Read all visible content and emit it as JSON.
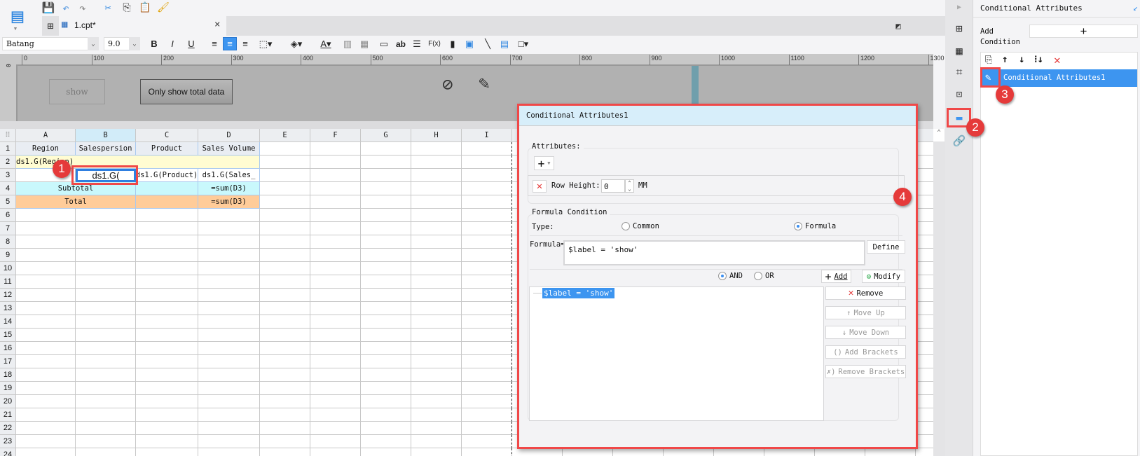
{
  "toolbar": {
    "icons": [
      "logo-icon",
      "save-icon",
      "undo-icon",
      "redo-icon",
      "cut-icon",
      "copy-icon",
      "paste-icon",
      "format-painter-icon"
    ]
  },
  "tab": {
    "label": "1.cpt*",
    "close": "×"
  },
  "format": {
    "font": "Batang",
    "size": "9.0",
    "bold": "B",
    "italic": "I",
    "underline": "U",
    "text_label": "ab",
    "formula": "F(x)"
  },
  "ruler": {
    "labels": [
      0,
      100,
      200,
      300,
      400,
      500,
      600,
      700,
      800,
      900,
      1000,
      1100,
      1200,
      1300
    ]
  },
  "report_body": {
    "show_button": "show",
    "total_button": "Only show total data"
  },
  "sheet": {
    "columns": [
      "A",
      "B",
      "C",
      "D",
      "E",
      "F",
      "G",
      "H",
      "I"
    ],
    "row_count": 24,
    "cells": [
      {
        "row": 1,
        "col": 0,
        "text": "Region",
        "style": "hdr"
      },
      {
        "row": 1,
        "col": 1,
        "text": "Salespersion",
        "style": "hdr"
      },
      {
        "row": 1,
        "col": 2,
        "text": "Product",
        "style": "hdr"
      },
      {
        "row": 1,
        "col": 3,
        "text": "Sales Volume",
        "style": "hdr"
      },
      {
        "row": 2,
        "col": 0,
        "span": 4,
        "text": "ds1.G(Region)",
        "style": "yellow",
        "align": "left"
      },
      {
        "row": 3,
        "col": 1,
        "text": "ds1.G(",
        "style": "editing"
      },
      {
        "row": 3,
        "col": 2,
        "text": "ds1.G(Product)",
        "style": "plain"
      },
      {
        "row": 3,
        "col": 3,
        "text": "ds1.G(Sales_",
        "style": "plain"
      },
      {
        "row": 4,
        "col": 0,
        "span": 2,
        "text": "Subtotal",
        "style": "cyan"
      },
      {
        "row": 4,
        "col": 2,
        "text": "",
        "style": "cyan"
      },
      {
        "row": 4,
        "col": 3,
        "text": "=sum(D3)",
        "style": "cyan"
      },
      {
        "row": 5,
        "col": 0,
        "span": 2,
        "text": "Total",
        "style": "orange"
      },
      {
        "row": 5,
        "col": 2,
        "text": "",
        "style": "orange"
      },
      {
        "row": 5,
        "col": 3,
        "text": "=sum(D3)",
        "style": "orange"
      }
    ]
  },
  "badges": [
    "1",
    "2",
    "3",
    "4"
  ],
  "panel": {
    "title": "Conditional Attributes",
    "add_condition": "Add Condition",
    "add_icon": "+",
    "items": [
      "Conditional Attributes1"
    ]
  },
  "dialog": {
    "title": "Conditional Attributes1",
    "attributes_label": "Attributes:",
    "row_height_label": "Row Height:",
    "row_height_value": "0",
    "unit": "MM",
    "formula_condition_label": "Formula Condition",
    "type_label": "Type:",
    "type_common": "Common",
    "type_formula": "Formula",
    "formula_label": "Formula=",
    "formula_value": "$label = 'show'",
    "define": "Define",
    "and": "AND",
    "or": "OR",
    "add": "Add",
    "modify": "Modify",
    "conditions": [
      "$label = 'show'"
    ],
    "remove": "Remove",
    "move_up": "Move Up",
    "move_down": "Move Down",
    "add_brackets": "Add Brackets",
    "remove_brackets": "Remove Brackets"
  },
  "colors": {
    "accent": "#3d95f0",
    "highlight": "#f04848",
    "yellow": "#fffcd2",
    "cyan": "#c9f8fc",
    "orange": "#ffcc99"
  }
}
